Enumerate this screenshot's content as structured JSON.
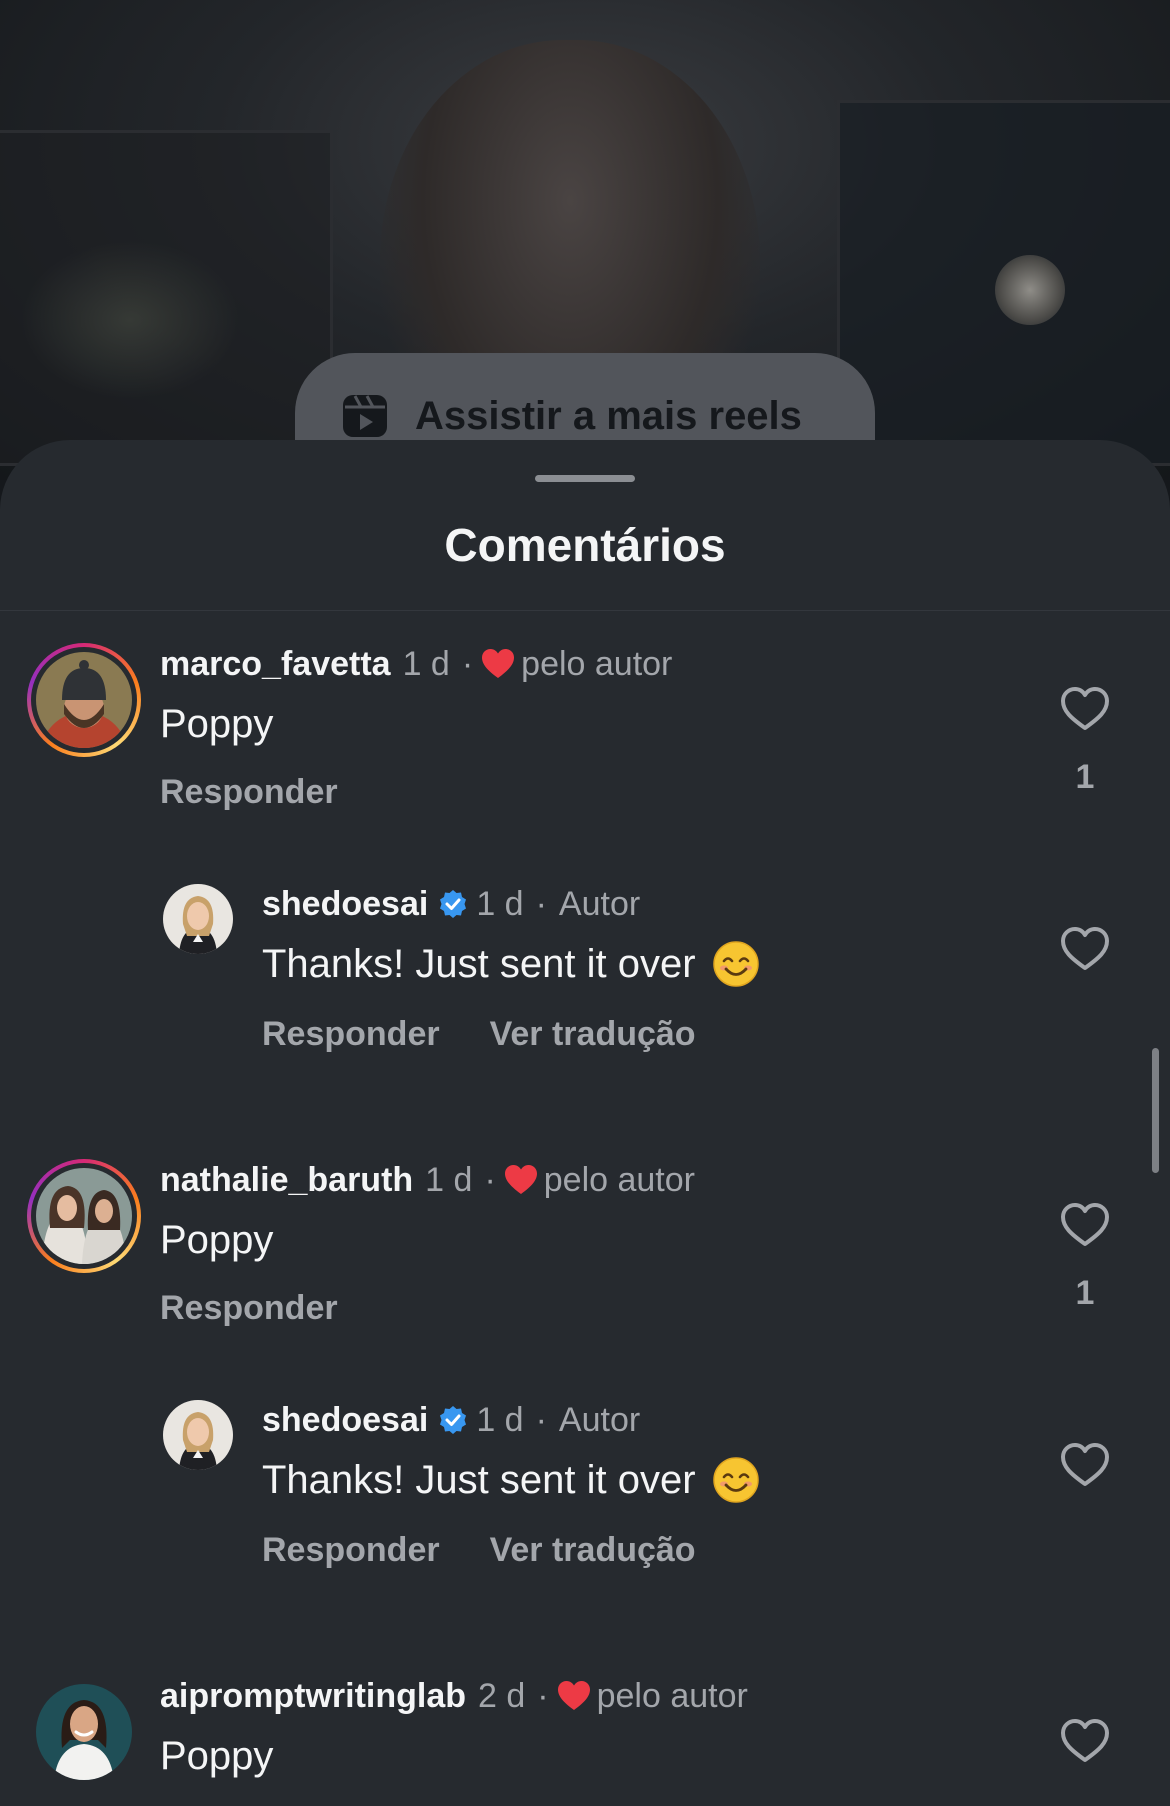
{
  "background": {
    "watch_more_label": "Assistir a mais reels"
  },
  "sheet": {
    "title": "Comentários"
  },
  "comments": [
    {
      "username": "marco_favetta",
      "time": "1 d",
      "separator": "·",
      "badge_text": "pelo autor",
      "text": "Poppy",
      "actions": [
        "Responder"
      ],
      "like_count": "1"
    },
    {
      "username": "shedoesai",
      "time": "1 d",
      "separator": "·",
      "badge_text": "Autor",
      "text": "Thanks! Just sent it over",
      "actions": [
        "Responder",
        "Ver tradução"
      ],
      "like_count": ""
    },
    {
      "username": "nathalie_baruth",
      "time": "1 d",
      "separator": "·",
      "badge_text": "pelo autor",
      "text": "Poppy",
      "actions": [
        "Responder"
      ],
      "like_count": "1"
    },
    {
      "username": "shedoesai",
      "time": "1 d",
      "separator": "·",
      "badge_text": "Autor",
      "text": "Thanks! Just sent it over",
      "actions": [
        "Responder",
        "Ver tradução"
      ],
      "like_count": ""
    },
    {
      "username": "aipromptwritinglab",
      "time": "2 d",
      "separator": "·",
      "badge_text": "pelo autor",
      "text": "Poppy",
      "actions": [],
      "like_count": ""
    }
  ],
  "colors": {
    "sheet_bg": "#262a2f",
    "primary_text": "#f4f5f6",
    "secondary_text": "#a3a6ab",
    "creator_heart": "#ed3a45",
    "verified_badge": "#3897f0"
  },
  "icons": {
    "reels": "reels-icon",
    "like": "heart-outline-icon",
    "creator_liked": "red-heart-icon",
    "verified": "verified-badge-icon",
    "emoji": "smiling-face-emoji"
  }
}
